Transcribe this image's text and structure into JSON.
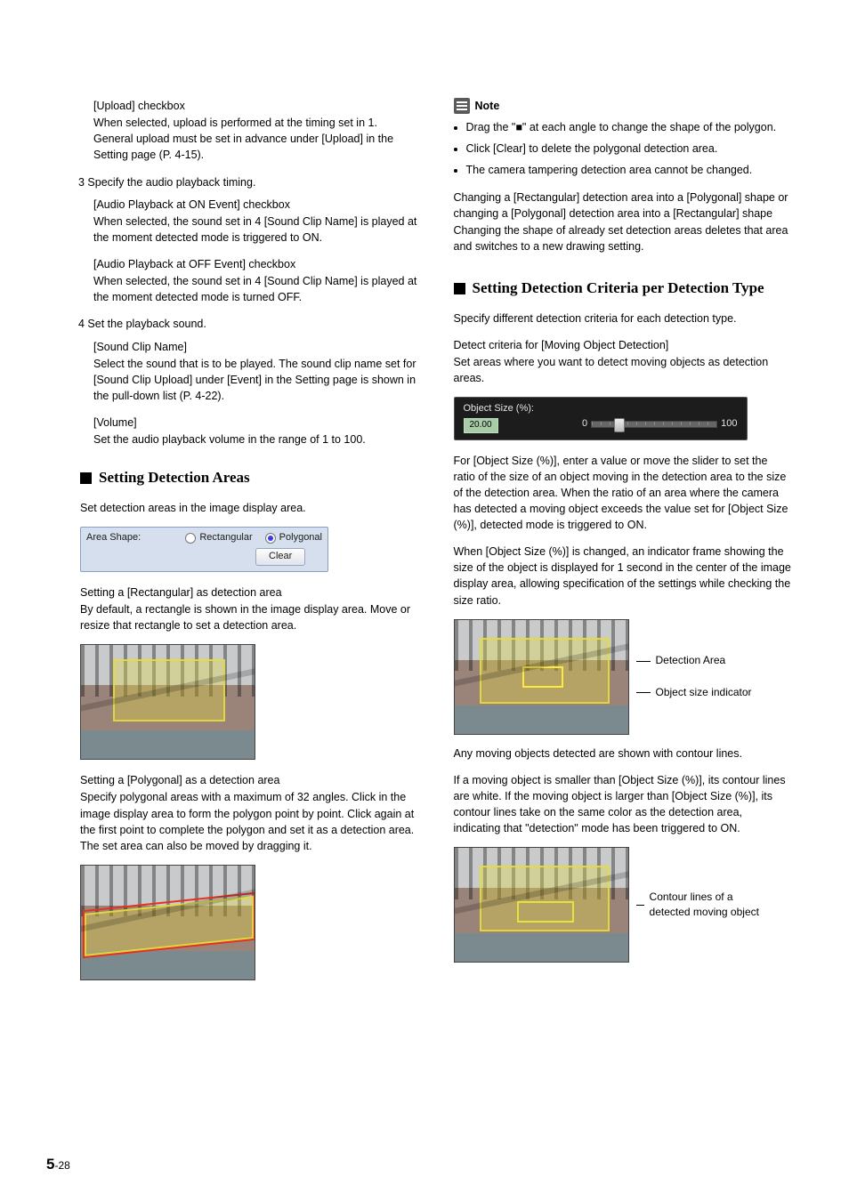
{
  "left": {
    "upload_cb_label": "[Upload] checkbox",
    "upload_cb_text": "When selected, upload is performed at the timing set in 1. General upload must be set in advance under [Upload] in the Setting page (P. 4-15).",
    "step3_label": "3 Specify the audio playback timing.",
    "audio_on_label": "[Audio Playback at ON Event] checkbox",
    "audio_on_text": "When selected, the sound set in 4 [Sound Clip Name] is played at the moment detected mode is triggered to ON.",
    "audio_off_label": "[Audio Playback at OFF Event] checkbox",
    "audio_off_text": "When selected, the sound set in 4 [Sound Clip Name] is played at the moment detected mode is turned OFF.",
    "step4_label": "4 Set the playback sound.",
    "sound_name_label": "[Sound Clip Name]",
    "sound_name_text": "Select the sound that is to be played. The sound clip name set for [Sound Clip Upload] under [Event] in the Setting page is shown in the pull-down list (P. 4-22).",
    "volume_label": "[Volume]",
    "volume_text": "Set the audio playback volume in the range of 1 to 100.",
    "h2_areas": "Setting Detection Areas",
    "areas_intro": "Set detection areas in the image display area.",
    "area_shape_label": "Area Shape:",
    "radio_rect": "Rectangular",
    "radio_poly": "Polygonal",
    "clear_btn": "Clear",
    "rect_head": "Setting a [Rectangular] as detection area",
    "rect_text": "By default, a rectangle is shown in the image display area. Move or resize that rectangle to set a detection area.",
    "poly_head": "Setting a [Polygonal] as a detection area",
    "poly_text": "Specify polygonal areas with a maximum of 32 angles. Click in the image display area to form the polygon point by point. Click again at the first point to complete the polygon and set it as a detection area. The set area can also be moved by dragging it."
  },
  "right": {
    "note_label": "Note",
    "note1": "Drag the \"■\" at each angle to change the shape of the polygon.",
    "note2": "Click [Clear] to delete the polygonal detection area.",
    "note3": "The camera tampering detection area cannot be changed.",
    "change_head": "Changing a [Rectangular] detection area into a [Polygonal] shape or changing a [Polygonal] detection area into a [Rectangular] shape",
    "change_text": "Changing the shape of already set detection areas deletes that area and switches to a new drawing setting.",
    "h2_criteria": "Setting Detection Criteria per Detection Type",
    "criteria_intro": "Specify different detection criteria for each detection type.",
    "detect_head": "Detect criteria for [Moving Object Detection]",
    "detect_text": "Set areas where you want to detect moving objects as detection areas.",
    "obj_size_label": "Object Size (%):",
    "obj_size_value": "20.00",
    "obj_size_min": "0",
    "obj_size_max": "100",
    "obj_para1": "For [Object Size (%)], enter a value or move the slider to set the ratio of the size of an object moving in the detection area to the size of the detection area. When the ratio of an area where the camera has detected a moving object exceeds the value set for [Object Size (%)], detected mode is triggered to ON.",
    "obj_para2": "When [Object Size (%)] is changed, an indicator frame showing the size of the object is displayed for 1 second in the center of the image display area, allowing specification of the settings while checking the size ratio.",
    "callout1": "Detection Area",
    "callout2": "Object size indicator",
    "contour_para1": "Any moving objects detected are shown with contour lines.",
    "contour_para2": "If a moving object is smaller than [Object Size (%)], its contour lines are white. If the moving object is larger than [Object Size (%)], its contour lines take on the same color as the detection area, indicating that \"detection\" mode has been triggered to ON.",
    "callout3": "Contour lines of a detected moving object"
  },
  "page_number_major": "5",
  "page_number_minor": "-28"
}
